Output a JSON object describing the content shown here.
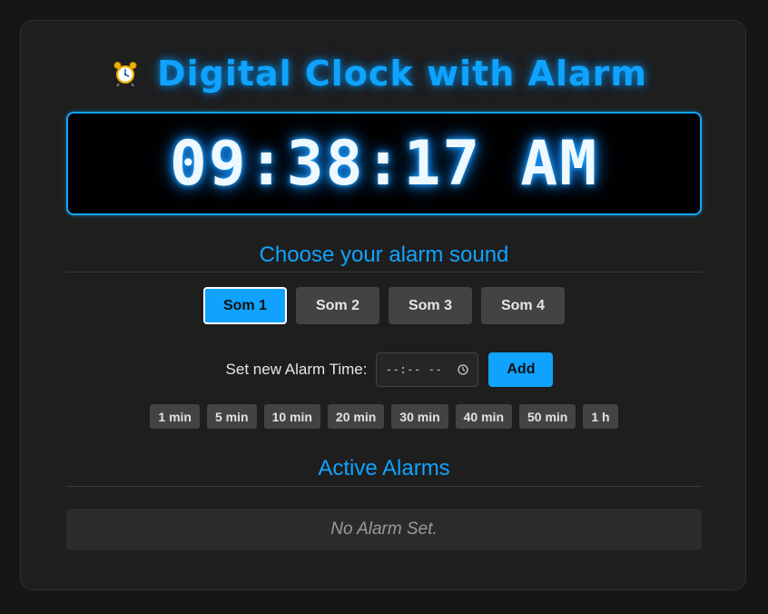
{
  "header": {
    "title": "Digital Clock with Alarm",
    "icon": "alarm-clock-icon"
  },
  "clock": {
    "time": "09:38:17 AM"
  },
  "sounds": {
    "heading": "Choose your alarm sound",
    "selected": "Som 1",
    "options": [
      "Som 1",
      "Som 2",
      "Som 3",
      "Som 4"
    ]
  },
  "alarm_form": {
    "label": "Set new Alarm Time:",
    "time_placeholder": "--:-- --",
    "time_value": "",
    "add_label": "Add"
  },
  "quick_add": [
    "1 min",
    "5 min",
    "10 min",
    "20 min",
    "30 min",
    "40 min",
    "50 min",
    "1 h"
  ],
  "active_alarms": {
    "heading": "Active Alarms",
    "empty_text": "No Alarm Set."
  },
  "colors": {
    "accent": "#0fa3ff",
    "background": "#161616",
    "card": "#1e1e1e",
    "button": "#434343"
  }
}
